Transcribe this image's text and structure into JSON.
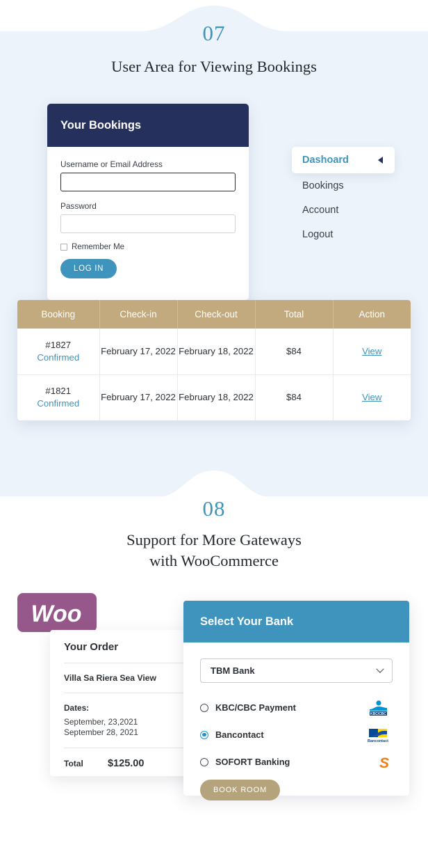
{
  "section07": {
    "number": "07",
    "title": "User Area for Viewing Bookings",
    "login_card": {
      "header": "Your Bookings",
      "username_label": "Username or Email Address",
      "username_value": "",
      "username_placeholder": "",
      "password_label": "Password",
      "password_value": "",
      "password_placeholder": "",
      "remember_label": "Remember Me",
      "login_button": "LOG IN"
    },
    "dashboard_menu": {
      "active_item": "Dashoard",
      "items": [
        {
          "label": "Bookings"
        },
        {
          "label": "Account"
        },
        {
          "label": "Logout"
        }
      ]
    },
    "bookings_table": {
      "columns": [
        "Booking",
        "Check-in",
        "Check-out",
        "Total",
        "Action"
      ],
      "rows": [
        {
          "booking_id": "#1827",
          "status": "Confirmed",
          "check_in": "February 17, 2022",
          "check_out": "February 18, 2022",
          "total": "$84",
          "action": "View"
        },
        {
          "booking_id": "#1821",
          "status": "Confirmed",
          "check_in": "February 17, 2022",
          "check_out": "February 18, 2022",
          "total": "$84",
          "action": "View"
        }
      ]
    }
  },
  "section08": {
    "number": "08",
    "title_line1": "Support for More Gateways",
    "title_line2": "with WooCommerce",
    "woo_logo_text": "Woo",
    "order_card": {
      "title": "Your Order",
      "room_name": "Villa Sa Riera Sea View",
      "dates_label": "Dates:",
      "date_from": "September, 23,2021",
      "date_to": "September 28, 2021",
      "total_label": "Total",
      "total_value": "$125.00"
    },
    "bank_panel": {
      "header": "Select Your Bank",
      "select_value": "TBM Bank",
      "select_icon": "chevron-down-icon",
      "payment_methods": [
        {
          "label": "KBC/CBC Payment",
          "selected": false,
          "logo": "kbc-cbc-logo"
        },
        {
          "label": "Bancontact",
          "selected": true,
          "logo": "bancontact-logo"
        },
        {
          "label": "SOFORT Banking",
          "selected": false,
          "logo": "sofort-logo"
        }
      ],
      "book_button": "BOOK ROOM"
    }
  },
  "colors": {
    "accent_blue": "#3e94bd",
    "dark_navy": "#26305c",
    "tan": "#c2aa7e",
    "button_tan": "#b5a37b",
    "band_bg": "#ecf3fb",
    "woo_purple": "#96588a"
  }
}
